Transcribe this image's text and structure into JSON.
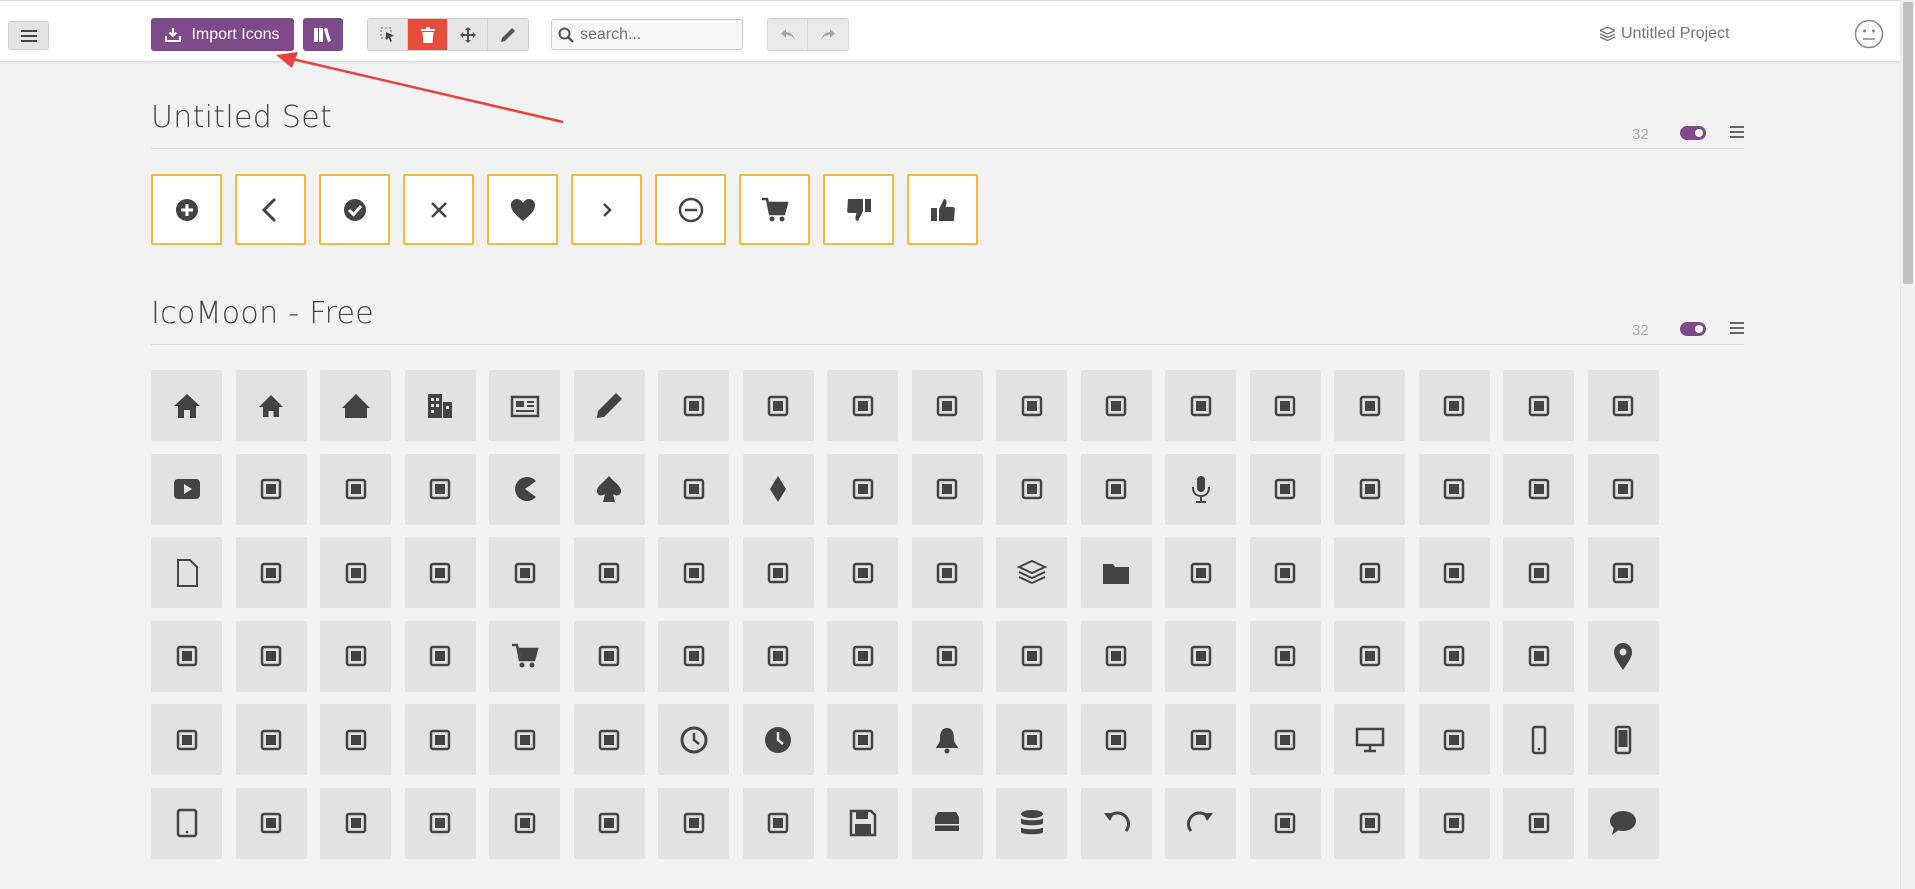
{
  "toolbar": {
    "import_label": "Import Icons",
    "search_placeholder": "search...",
    "project_name": "Untitled Project"
  },
  "colors": {
    "accent": "#7f4a8a",
    "delete": "#e74c3c",
    "selected_border": "#f5b941",
    "annotation_arrow": "#e8433a"
  },
  "sets": [
    {
      "title": "Untitled Set",
      "count": "32",
      "enabled": true,
      "icons": [
        "plus-circle-icon",
        "chevron-left-icon",
        "checkmark-circle-icon",
        "cross-icon",
        "heart-icon",
        "chevron-right-icon",
        "minus-circle-icon",
        "cart-icon",
        "thumbs-down-icon",
        "thumbs-up-icon"
      ]
    },
    {
      "title": "IcoMoon - Free",
      "count": "32",
      "enabled": true,
      "icons": [
        "home-icon",
        "home2-icon",
        "home3-icon",
        "office-icon",
        "newspaper-icon",
        "pencil-icon",
        "pencil2-icon",
        "quill-icon",
        "pen-icon",
        "blog-icon",
        "eyedropper-icon",
        "droplet-icon",
        "paint-format-icon",
        "image-icon",
        "images-icon",
        "camera-icon",
        "headphones-icon",
        "music-icon",
        "play-icon",
        "film-icon",
        "video-camera-icon",
        "dice-icon",
        "pacman-icon",
        "spades-icon",
        "clubs-icon",
        "diamonds-icon",
        "bullhorn-icon",
        "connection-icon",
        "podcast-icon",
        "feed-icon",
        "mic-icon",
        "book-icon",
        "books-icon",
        "library-icon",
        "file-text-icon",
        "profile-icon",
        "file-empty-icon",
        "files-empty-icon",
        "file-text2-icon",
        "file-picture-icon",
        "file-music-icon",
        "file-play-icon",
        "file-video-icon",
        "file-zip-icon",
        "copy-icon",
        "paste-icon",
        "stack-icon",
        "folder-icon",
        "folder-open-icon",
        "folder-plus-icon",
        "folder-minus-icon",
        "folder-download-icon",
        "folder-upload-icon",
        "price-tag-icon",
        "price-tags-icon",
        "barcode-icon",
        "qrcode-icon",
        "ticket-icon",
        "cart-icon",
        "coin-dollar-icon",
        "coin-euro-icon",
        "coin-pound-icon",
        "coin-yen-icon",
        "credit-card-icon",
        "calculator-icon",
        "lifebuoy-icon",
        "phone-icon",
        "phone-hang-up-icon",
        "address-book-icon",
        "envelop-icon",
        "pushpin-icon",
        "location-icon",
        "location2-icon",
        "compass-icon",
        "compass2-icon",
        "map-icon",
        "map2-icon",
        "history-icon",
        "clock-icon",
        "clock2-icon",
        "alarm-icon",
        "bell-icon",
        "stopwatch-icon",
        "calendar-icon",
        "printer-icon",
        "keyboard-icon",
        "display-icon",
        "laptop-icon",
        "mobile-icon",
        "mobile2-icon",
        "tablet-icon",
        "tv-icon",
        "drawer-icon",
        "drawer2-icon",
        "box-add-icon",
        "box-remove-icon",
        "download-icon",
        "upload-icon",
        "floppy-disk-icon",
        "drive-icon",
        "database-icon",
        "undo-icon",
        "redo-icon",
        "undo2-icon",
        "redo2-icon",
        "forward-icon",
        "reply-icon",
        "bubble-icon"
      ]
    }
  ]
}
